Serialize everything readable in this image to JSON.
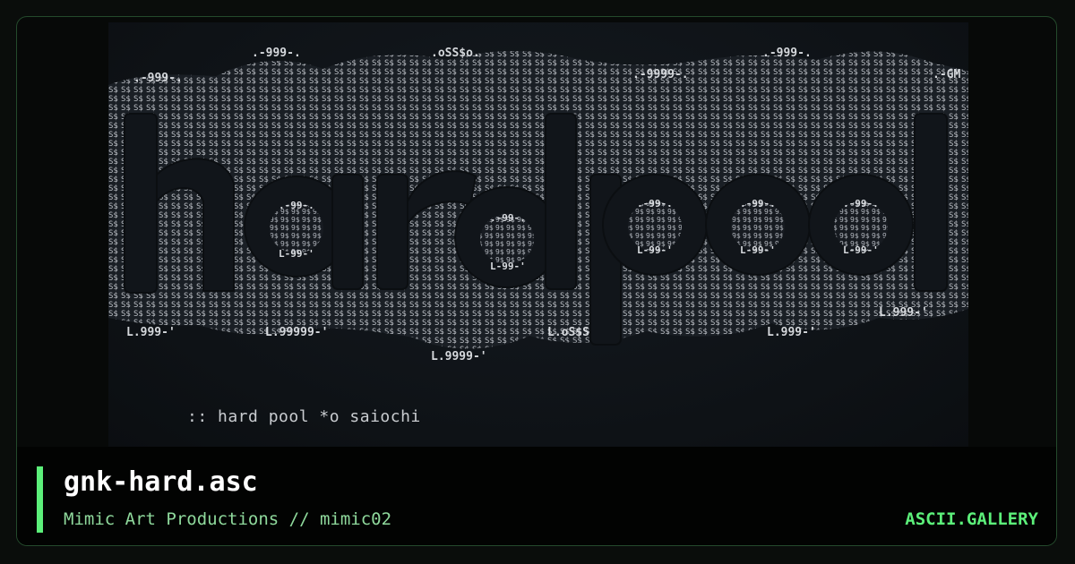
{
  "artwork": {
    "ascii_logo": "hardpool",
    "caption": ":: hard pool *o saiochi"
  },
  "file": {
    "title": "gnk-hard.asc",
    "author_line": "Mimic Art Productions // mimic02"
  },
  "site": {
    "brand": "ASCII.GALLERY"
  },
  "colors": {
    "accent": "#5cf07a",
    "author_text": "#8fd99c",
    "background": "#070908",
    "border": "#244a2c"
  }
}
